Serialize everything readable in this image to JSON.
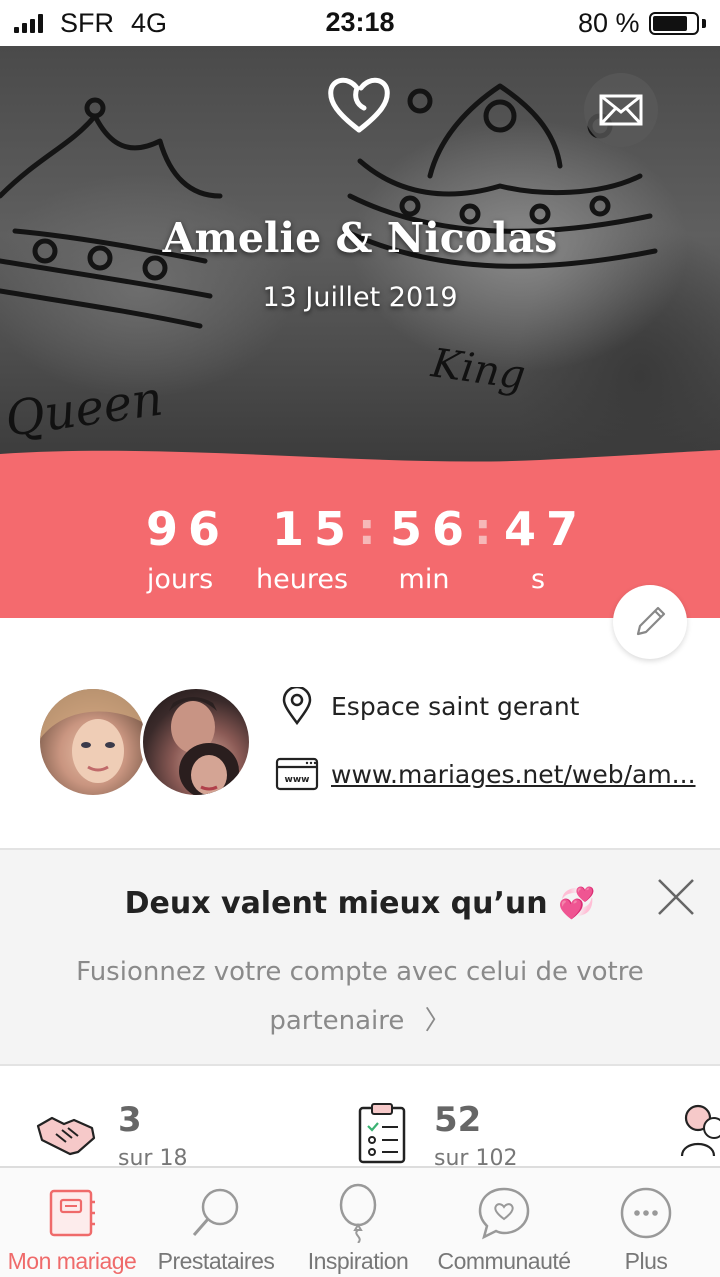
{
  "status_bar": {
    "carrier": "SFR",
    "network": "4G",
    "time": "23:18",
    "battery": "80 %",
    "battery_level": 0.8
  },
  "hero": {
    "title": "Amelie & Nicolas",
    "date": "13 Juillet 2019",
    "tattoo_left_text": "Queen",
    "tattoo_right_text": "King",
    "icons": [
      "heart-logo-icon",
      "envelope-icon"
    ]
  },
  "countdown": {
    "days": "96",
    "hours": "15",
    "minutes": "56",
    "seconds": "47",
    "days_label": "jours",
    "hours_label": "heures",
    "minutes_label": "min",
    "seconds_label": "s",
    "colors": {
      "band": "#f46a6e",
      "colon": "#f6b8b8"
    }
  },
  "info": {
    "venue": "Espace saint gerant",
    "website": "www.mariages.net/web/am..."
  },
  "merge_banner": {
    "title": "Deux valent mieux qu’un 💞",
    "text": "Fusionnez votre compte avec celui de votre partenaire",
    "chevron": "〉"
  },
  "stats": [
    {
      "icon": "handshake-icon",
      "value": "3",
      "sub": "sur 18"
    },
    {
      "icon": "checklist-icon",
      "value": "52",
      "sub": "sur 102"
    },
    {
      "icon": "guests-icon",
      "value": "",
      "sub": ""
    }
  ],
  "tabs": [
    {
      "label": "Mon mariage",
      "icon": "wedding-book-icon",
      "active": true
    },
    {
      "label": "Prestataires",
      "icon": "magnifier-icon",
      "active": false
    },
    {
      "label": "Inspiration",
      "icon": "balloon-icon",
      "active": false
    },
    {
      "label": "Communauté",
      "icon": "chat-heart-icon",
      "active": false
    },
    {
      "label": "Plus",
      "icon": "more-icon",
      "active": false
    }
  ],
  "colors": {
    "accent": "#ef6a6a"
  }
}
